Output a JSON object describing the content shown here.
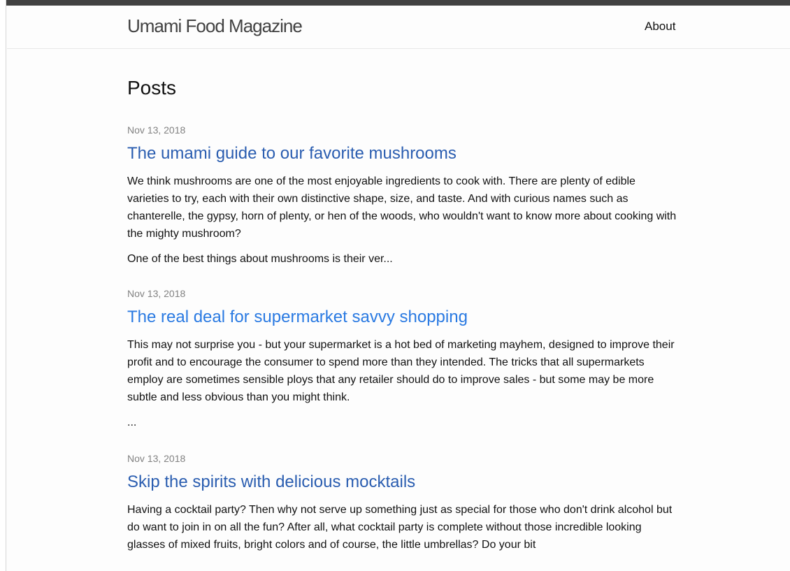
{
  "site": {
    "title": "Umami Food Magazine",
    "nav": [
      {
        "label": "About"
      }
    ]
  },
  "page": {
    "heading": "Posts"
  },
  "posts": [
    {
      "date": "Nov 13, 2018",
      "title": "The umami guide to our favorite mushrooms",
      "link_color": "#2a5db0",
      "paragraphs": [
        "We think mushrooms are one of the most enjoyable ingredients to cook with. There are plenty of edible varieties to try, each with their own distinctive shape, size, and taste. And with curious names such as chanterelle, the gypsy, horn of plenty, or hen of the woods, who wouldn't want to know more about cooking with the mighty mushroom?",
        "One of the best things about mushrooms is their ver..."
      ]
    },
    {
      "date": "Nov 13, 2018",
      "title": "The real deal for supermarket savvy shopping",
      "link_color": "#2a7ae2",
      "paragraphs": [
        "This may not surprise you - but your supermarket is a hot bed of marketing mayhem, designed to improve their profit and to encourage the consumer to spend more than they intended. The tricks that all supermarkets employ are sometimes sensible ploys that any retailer should do to improve sales - but some may be more subtle and less obvious than you might think.",
        "..."
      ]
    },
    {
      "date": "Nov 13, 2018",
      "title": "Skip the spirits with delicious mocktails",
      "link_color": "#2a5db0",
      "paragraphs": [
        "Having a cocktail party? Then why not serve up something just as special for those who don't drink alcohol but do want to join in on all the fun? After all, what cocktail party is complete without those incredible looking glasses of mixed fruits, bright colors and of course, the little umbrellas? Do your bit"
      ]
    }
  ]
}
